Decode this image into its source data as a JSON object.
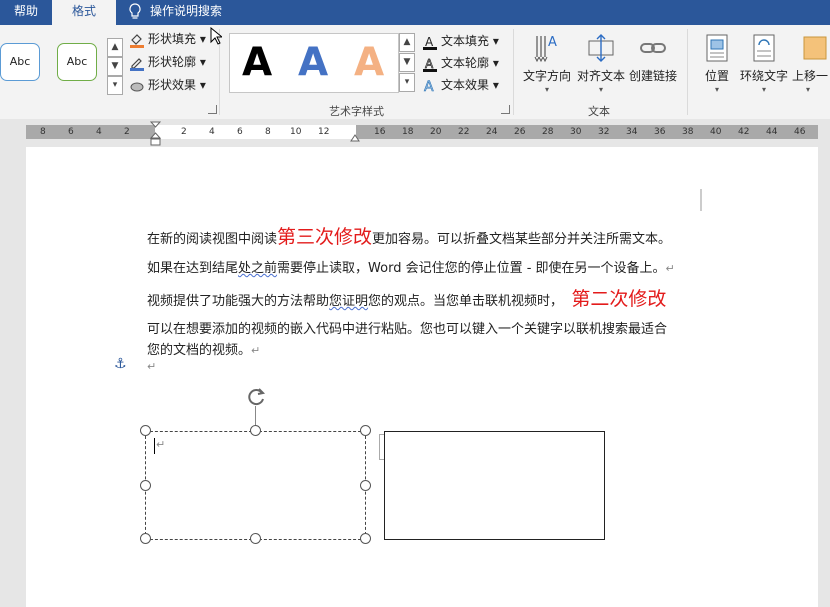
{
  "tabs": {
    "help": "帮助",
    "format": "格式",
    "tell_me": "操作说明搜索"
  },
  "shape_styles": {
    "style1_label": "Abc",
    "style2_label": "Abc",
    "shape_fill": "形状填充",
    "shape_outline": "形状轮廓",
    "shape_effects": "形状效果"
  },
  "wordart": {
    "sample_letter": "A",
    "group_label": "艺术字样式",
    "text_fill": "文本填充",
    "text_outline": "文本轮廓",
    "text_effects": "文本效果"
  },
  "text_group": {
    "direction": "文字方向",
    "align": "对齐文本",
    "link": "创建链接",
    "group_label": "文本"
  },
  "arrange": {
    "position": "位置",
    "wrap": "环绕文字",
    "forward": "上移一"
  },
  "ruler": {
    "left_numbers": [
      "8",
      "6",
      "4",
      "2"
    ],
    "right_numbers": [
      "2",
      "4",
      "6",
      "8",
      "10",
      "12",
      "16",
      "18",
      "20",
      "22",
      "24",
      "26",
      "28",
      "30",
      "32",
      "34",
      "36",
      "38",
      "40",
      "42",
      "44",
      "46"
    ]
  },
  "document": {
    "line1_a": "在新的阅读视图中阅读",
    "line1_red": "第三次修改",
    "line1_b": "更加容易。可以折叠文档某些部分并关注所需文本。",
    "line2_a": "如果在达到结尾",
    "line2_wavy": "处之前",
    "line2_b": "需要停止读取，Word  会记住您的停止位置  -  即使在另一个设备上。",
    "line3_a": "视频提供了功能强大的方法帮助",
    "line3_wavy": "您证明",
    "line3_b": "您的观点。当您单击联机视频时，",
    "line3_red": "第二次修改",
    "line4": "可以在想要添加的视频的嵌入代码中进行粘贴。您也可以键入一个关键字以联机搜索最适合",
    "line5": "您的文档的视频。",
    "para_mark": "↵",
    "anchor_icon": "⚓",
    "textbox_mark": "↵",
    "rotate_icon": "rotate-handle-icon",
    "layout_icon": "layout-options-icon"
  },
  "colors": {
    "brand": "#2b579a",
    "red_text": "#e31b1b",
    "wordart_blue": "#4472c4",
    "wordart_orange": "#f4b183",
    "abc1": "#5b9bd5",
    "abc2": "#70ad47"
  }
}
